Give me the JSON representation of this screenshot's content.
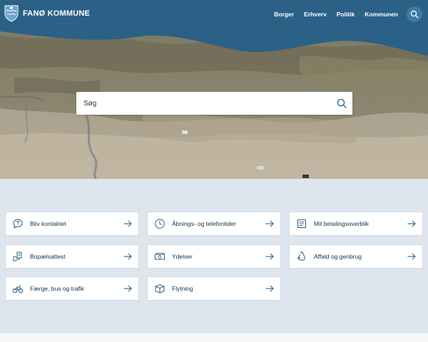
{
  "header": {
    "logo_text": "FANØ KOMMUNE",
    "logo_icon": "coat-of-arms-icon",
    "nav": [
      {
        "label": "Borger"
      },
      {
        "label": "Erhverv"
      },
      {
        "label": "Politik"
      },
      {
        "label": "Kommunen"
      }
    ],
    "search_icon": "search-icon"
  },
  "hero": {
    "image": "aerial-beach-dunes",
    "search": {
      "placeholder": "Søg",
      "icon": "search-icon"
    }
  },
  "cards": [
    {
      "label": "Bliv kontaktet",
      "icon": "question-bubble-icon"
    },
    {
      "label": "Åbnings- og telefontider",
      "icon": "clock-icon"
    },
    {
      "label": "Mit betalingsoverblik",
      "icon": "invoice-icon"
    },
    {
      "label": "Bopælsattest",
      "icon": "hand-document-icon"
    },
    {
      "label": "Ydelser",
      "icon": "money-icon"
    },
    {
      "label": "Affald og genbrug",
      "icon": "recycle-icon"
    },
    {
      "label": "Færge, bus og trafik",
      "icon": "bike-icon"
    },
    {
      "label": "Flytning",
      "icon": "moving-box-icon"
    }
  ],
  "colors": {
    "header_bg": "#2b6186",
    "page_bg": "#dde6ee",
    "card_border": "#cfdbe6",
    "icon_stroke": "#2b6186"
  }
}
